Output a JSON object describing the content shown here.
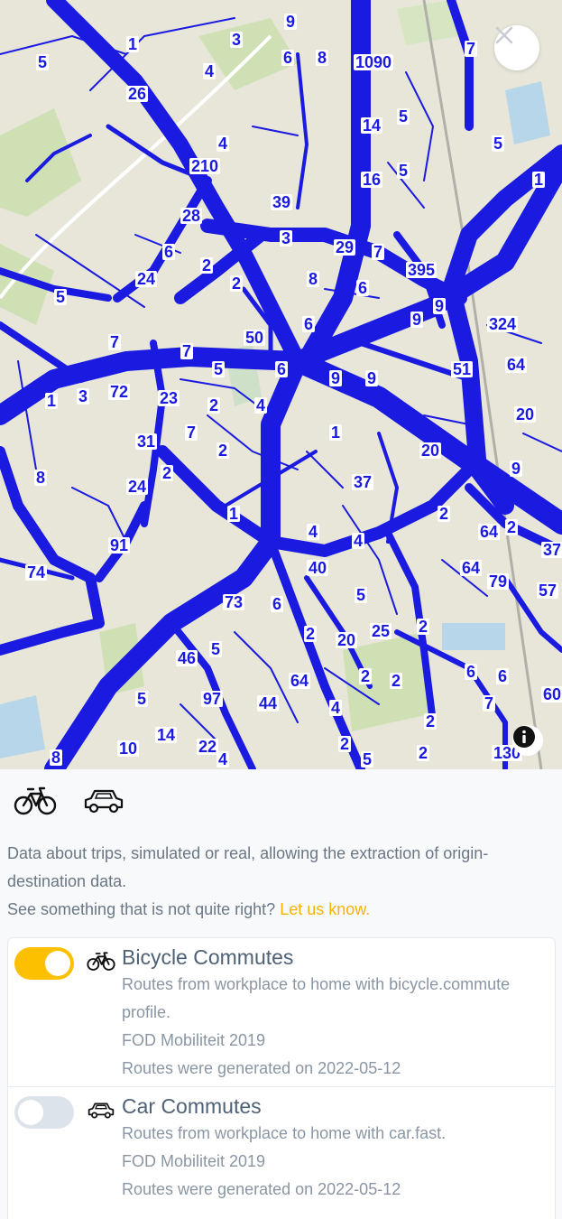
{
  "map": {
    "route_color": "#1a1ae0",
    "labels": [
      "1",
      "5",
      "26",
      "4",
      "3",
      "6",
      "9",
      "8",
      "1090",
      "14",
      "16",
      "5",
      "5",
      "7",
      "5",
      "1",
      "210",
      "4",
      "39",
      "3",
      "29",
      "7",
      "395",
      "6",
      "9",
      "28",
      "6",
      "2",
      "8",
      "6",
      "2",
      "24",
      "5",
      "50",
      "6",
      "9",
      "9",
      "324",
      "64",
      "7",
      "7",
      "5",
      "9",
      "51",
      "1",
      "3",
      "72",
      "23",
      "2",
      "4",
      "1",
      "20",
      "7",
      "2",
      "20",
      "31",
      "2",
      "37",
      "9",
      "8",
      "24",
      "1",
      "2",
      "64",
      "64",
      "2",
      "37",
      "91",
      "4",
      "4",
      "40",
      "79",
      "57",
      "74",
      "73",
      "6",
      "5",
      "2",
      "2",
      "20",
      "25",
      "2",
      "6",
      "6",
      "60",
      "46",
      "5",
      "64",
      "2",
      "2",
      "7",
      "5",
      "97",
      "44",
      "4",
      "2",
      "2",
      "130",
      "8",
      "10",
      "14",
      "22",
      "4",
      "5"
    ]
  },
  "close_icon": "close-icon",
  "info_icon": "info-icon",
  "modes": [
    {
      "icon": "bicycle-icon"
    },
    {
      "icon": "car-icon"
    }
  ],
  "description": {
    "text": "Data about trips, simulated or real, allowing the extraction of origin-destination data.",
    "feedback_prompt": "See something that is not quite right?",
    "feedback_link": "Let us know."
  },
  "layers": [
    {
      "enabled": true,
      "icon": "bicycle-icon",
      "title": "Bicycle Commutes",
      "description": "Routes from workplace to home with bicycle.commute profile.",
      "source": "FOD Mobiliteit 2019",
      "generated": "Routes were generated on 2022-05-12"
    },
    {
      "enabled": false,
      "icon": "car-icon",
      "title": "Car Commutes",
      "description": "Routes from workplace to home with car.fast.",
      "source": "FOD Mobiliteit 2019",
      "generated": "Routes were generated on 2022-05-12"
    }
  ],
  "colors": {
    "toggle_on": "#fcc000",
    "toggle_off": "#dde3ea",
    "link": "#f5b400"
  }
}
